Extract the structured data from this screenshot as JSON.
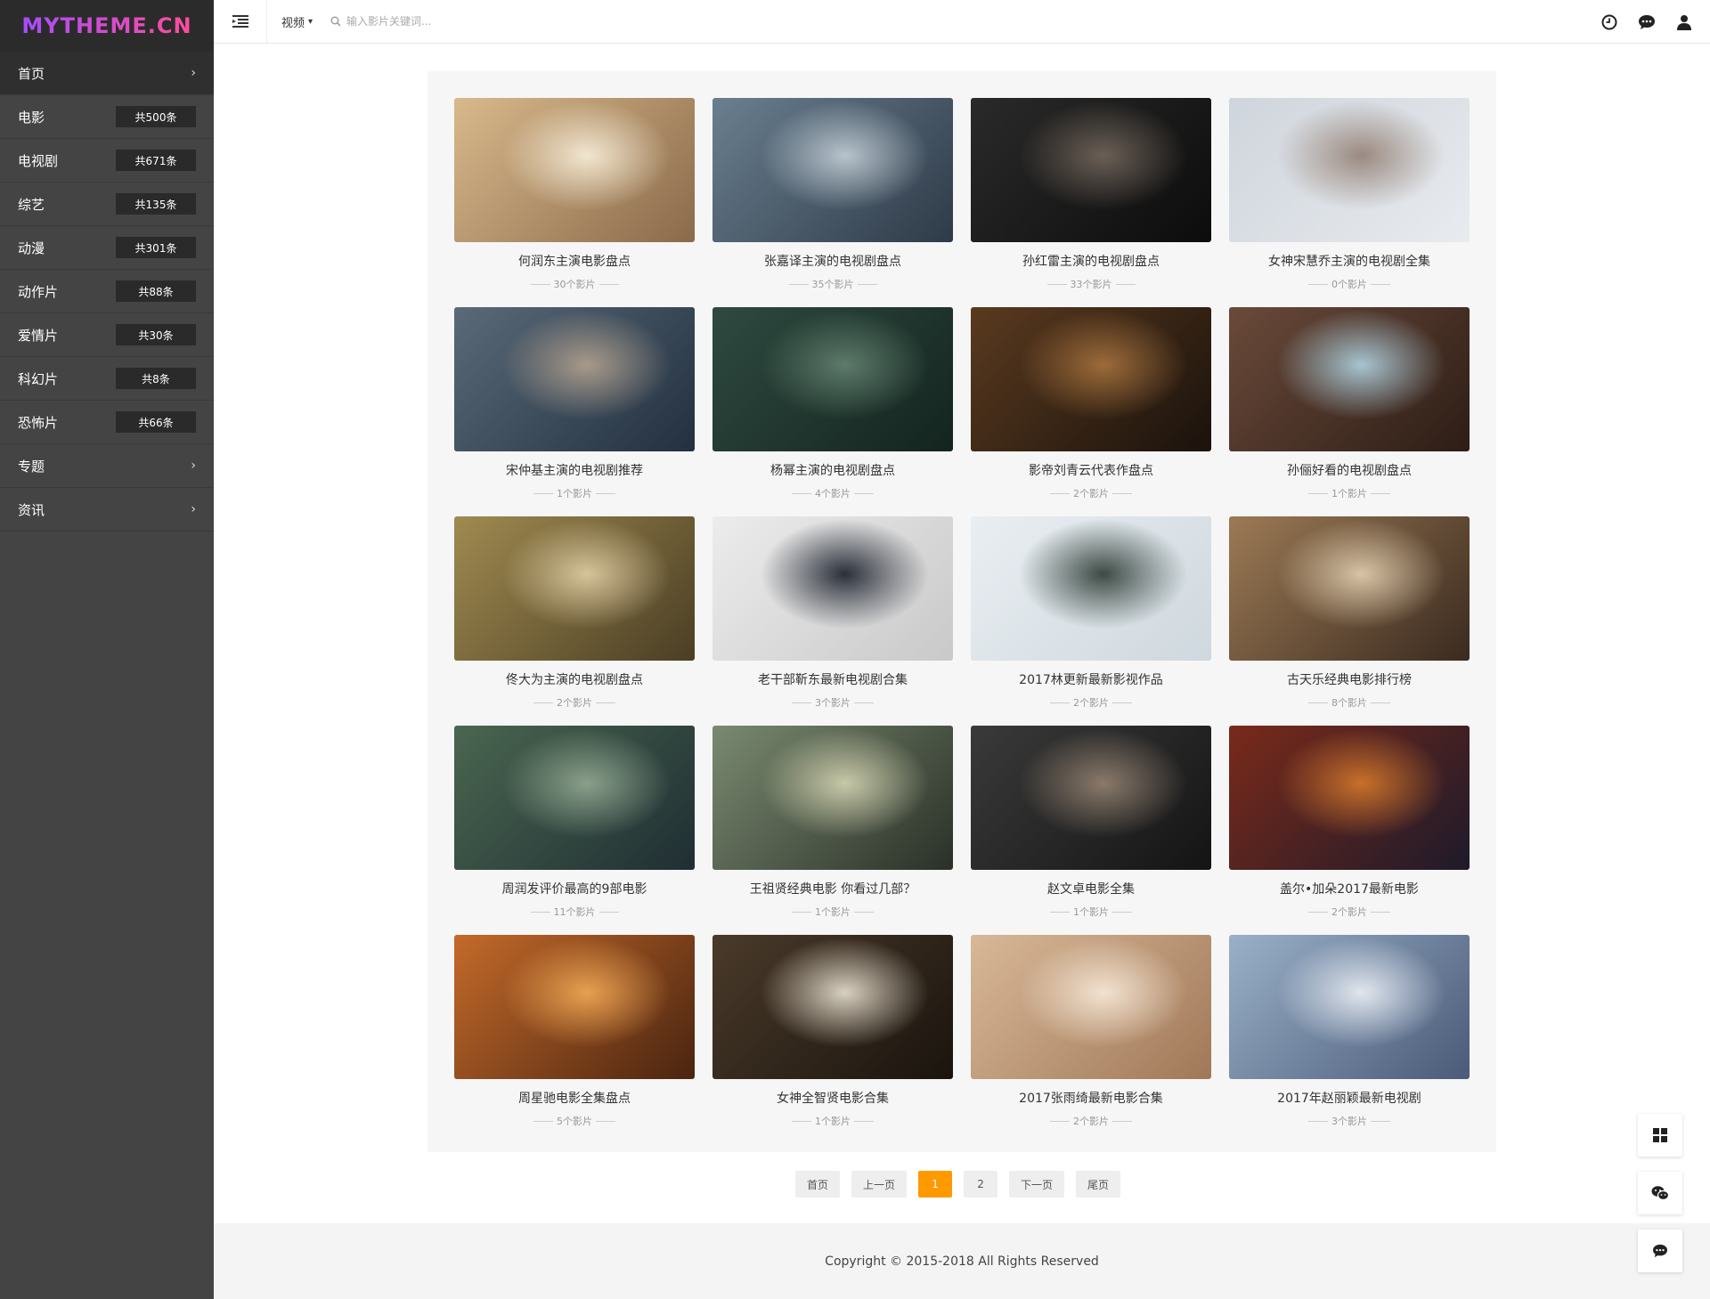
{
  "brand": {
    "logo_text": "MYTHEME.CN"
  },
  "sidebar": {
    "items": [
      {
        "label": "首页",
        "badge": "",
        "chevron": true
      },
      {
        "label": "电影",
        "badge": "共500条",
        "chevron": false
      },
      {
        "label": "电视剧",
        "badge": "共671条",
        "chevron": false
      },
      {
        "label": "综艺",
        "badge": "共135条",
        "chevron": false
      },
      {
        "label": "动漫",
        "badge": "共301条",
        "chevron": false
      },
      {
        "label": "动作片",
        "badge": "共88条",
        "chevron": false
      },
      {
        "label": "爱情片",
        "badge": "共30条",
        "chevron": false
      },
      {
        "label": "科幻片",
        "badge": "共8条",
        "chevron": false
      },
      {
        "label": "恐怖片",
        "badge": "共66条",
        "chevron": false
      },
      {
        "label": "专题",
        "badge": "",
        "chevron": true
      },
      {
        "label": "资讯",
        "badge": "",
        "chevron": true
      }
    ]
  },
  "header": {
    "category_label": "视频",
    "search_placeholder": "输入影片关键词..."
  },
  "cards": [
    {
      "title": "何润东主演电影盘点",
      "count": "30个影片",
      "colors": [
        "#d8b98c",
        "#8a6a4a",
        "#f2e6d0"
      ]
    },
    {
      "title": "张嘉译主演的电视剧盘点",
      "count": "35个影片",
      "colors": [
        "#6a7f8f",
        "#2e3a48",
        "#b7c3cc"
      ]
    },
    {
      "title": "孙红雷主演的电视剧盘点",
      "count": "33个影片",
      "colors": [
        "#2a2a2a",
        "#0c0c0c",
        "#6b5f55"
      ]
    },
    {
      "title": "女神宋慧乔主演的电视剧全集",
      "count": "0个影片",
      "colors": [
        "#cfd5dc",
        "#e8ebef",
        "#9b8a80"
      ]
    },
    {
      "title": "宋仲基主演的电视剧推荐",
      "count": "1个影片",
      "colors": [
        "#5a6a78",
        "#223040",
        "#a89a8a"
      ]
    },
    {
      "title": "杨幂主演的电视剧盘点",
      "count": "4个影片",
      "colors": [
        "#2f4a40",
        "#13241e",
        "#5d7a6a"
      ]
    },
    {
      "title": "影帝刘青云代表作盘点",
      "count": "2个影片",
      "colors": [
        "#5a3a1f",
        "#1a120c",
        "#9c6b3a"
      ]
    },
    {
      "title": "孙俪好看的电视剧盘点",
      "count": "1个影片",
      "colors": [
        "#6a4a3a",
        "#2d1d16",
        "#a7c4d0"
      ]
    },
    {
      "title": "佟大为主演的电视剧盘点",
      "count": "2个影片",
      "colors": [
        "#a08a50",
        "#4a3e24",
        "#d5c39a"
      ]
    },
    {
      "title": "老干部靳东最新电视剧合集",
      "count": "3个影片",
      "colors": [
        "#ececec",
        "#c9c9c9",
        "#2a2f3a"
      ]
    },
    {
      "title": "2017林更新最新影视作品",
      "count": "2个影片",
      "colors": [
        "#e9eef2",
        "#cfd8de",
        "#3c4a44"
      ]
    },
    {
      "title": "古天乐经典电影排行榜",
      "count": "8个影片",
      "colors": [
        "#9c7a55",
        "#3a2a1f",
        "#d7c3a5"
      ]
    },
    {
      "title": "周润发评价最高的9部电影",
      "count": "11个影片",
      "colors": [
        "#4a6650",
        "#1f2e33",
        "#8aa08a"
      ]
    },
    {
      "title": "王祖贤经典电影 你看过几部？",
      "count": "1个影片",
      "colors": [
        "#7a8a70",
        "#2a3028",
        "#c8c8a8"
      ]
    },
    {
      "title": "赵文卓电影全集",
      "count": "1个影片",
      "colors": [
        "#3a3a3a",
        "#141414",
        "#8a7a6a"
      ]
    },
    {
      "title": "盖尔•加朵2017最新电影",
      "count": "2个影片",
      "colors": [
        "#7a2a1a",
        "#1e1a2a",
        "#c8702a"
      ]
    },
    {
      "title": "周星驰电影全集盘点",
      "count": "5个影片",
      "colors": [
        "#c46a2a",
        "#4a2410",
        "#e8a050"
      ]
    },
    {
      "title": "女神全智贤电影合集",
      "count": "1个影片",
      "colors": [
        "#4a3a2a",
        "#1a140e",
        "#d8d0c0"
      ]
    },
    {
      "title": "2017张雨绮最新电影合集",
      "count": "2个影片",
      "colors": [
        "#d8b898",
        "#a07858",
        "#f2e2d0"
      ]
    },
    {
      "title": "2017年赵丽颖最新电视剧",
      "count": "3个影片",
      "colors": [
        "#9ab0c8",
        "#4a5a78",
        "#e0e6ee"
      ]
    }
  ],
  "pagination": {
    "first": "首页",
    "prev": "上一页",
    "pages": [
      "1",
      "2"
    ],
    "current": "1",
    "next": "下一页",
    "last": "尾页"
  },
  "footer": {
    "copyright": "Copyright © 2015-2018 All Rights Reserved"
  },
  "floating": {
    "buttons": [
      {
        "icon": "windows-icon"
      },
      {
        "icon": "wechat-icon"
      },
      {
        "icon": "chat-icon"
      }
    ]
  },
  "top_icons": [
    "clock-icon",
    "chat-bubble-icon",
    "user-icon"
  ],
  "theme": {
    "accent": "#ff9900",
    "sidebar_bg": "#444444",
    "sidebar_dark": "#2b2b2b"
  }
}
